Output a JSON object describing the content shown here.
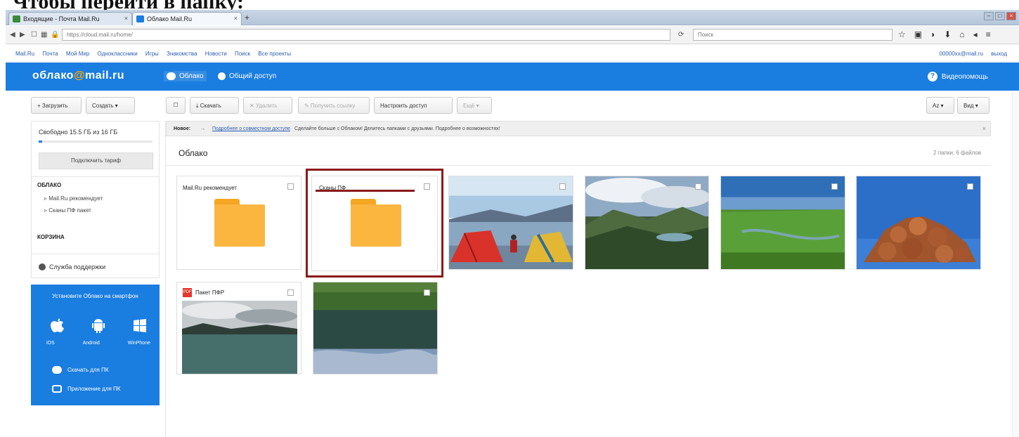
{
  "caption": "Чтобы перейти в папку:",
  "browser": {
    "tabs": [
      {
        "label": "Входящие - Почта Mail.Ru",
        "close": "×"
      },
      {
        "label": "Облако Mail.Ru",
        "close": "×"
      }
    ],
    "new_tab": "+",
    "url": "https://cloud.mail.ru/home/",
    "search_placeholder": "Поиск",
    "bookmarks": [
      "Mail.Ru",
      "Почта",
      "Мой Мир",
      "Одноклассники",
      "Игры",
      "Знакомства",
      "Новости",
      "Поиск",
      "Все проекты"
    ],
    "user_account": "00000xx@mail.ru",
    "logout": "выход"
  },
  "header": {
    "logo_prefix": "облако",
    "logo_at": "@",
    "logo_suffix": "mail.ru",
    "nav": [
      "Облако",
      "Общий доступ"
    ],
    "help": "Видеопомощь"
  },
  "toolbar": {
    "upload": "+ Загрузить",
    "create": "Создать ▾",
    "select_all": "☐",
    "download": "⤓ Скачать",
    "delete": "✕ Удалить",
    "get_link": "✎ Получить ссылку",
    "share": "Настроить доступ",
    "more": "Ещё ▾",
    "sort": "Az ▾",
    "view": "Вид ▾"
  },
  "sidebar": {
    "quota": "Свободно 15.5 ГБ из 16 ГБ",
    "quota_used_fraction": 0.03,
    "upgrade": "Подключить тариф",
    "cloud_heading": "ОБЛАКО",
    "folders": [
      "Mail.Ru рекомендует",
      "Сканы ПФ пакет"
    ],
    "trash": "КОРЗИНА",
    "support": "Служба поддержки"
  },
  "promo": {
    "title": "Установите Облако на смартфон",
    "icons": [
      "",
      "🤖",
      "⊞"
    ],
    "platforms": [
      "iOS",
      "Android",
      "WinPhone"
    ],
    "links": [
      "Скачать для ПК",
      "Приложение для ПК"
    ]
  },
  "banner": {
    "label": "Новое:",
    "link": "Подробнее о совместном доступе",
    "text": "Сделайте больше с Облаком! Делитесь папками с друзьями. Подробнее о возможностях!",
    "close": "×"
  },
  "folder": {
    "title": "Облако",
    "count": "2 папки, 6 файлов"
  },
  "tiles": [
    {
      "type": "folder",
      "label": "Mail.Ru рекомендует"
    },
    {
      "type": "folder",
      "label": "Сканы ПФ",
      "highlighted": true
    },
    {
      "type": "photo",
      "label": "Палатки у озера"
    },
    {
      "type": "photo",
      "label": "Горы и облака"
    },
    {
      "type": "photo",
      "label": "Зелёная долина"
    },
    {
      "type": "photo",
      "label": "Каменная горка"
    },
    {
      "type": "pdf",
      "label": "Пакет ПФР"
    },
    {
      "type": "photo",
      "label": "Лесное озеро"
    }
  ],
  "colors": {
    "brand_blue": "#1a7de0",
    "folder_yellow": "#fbb640",
    "highlight_red": "#8b1a1a"
  }
}
